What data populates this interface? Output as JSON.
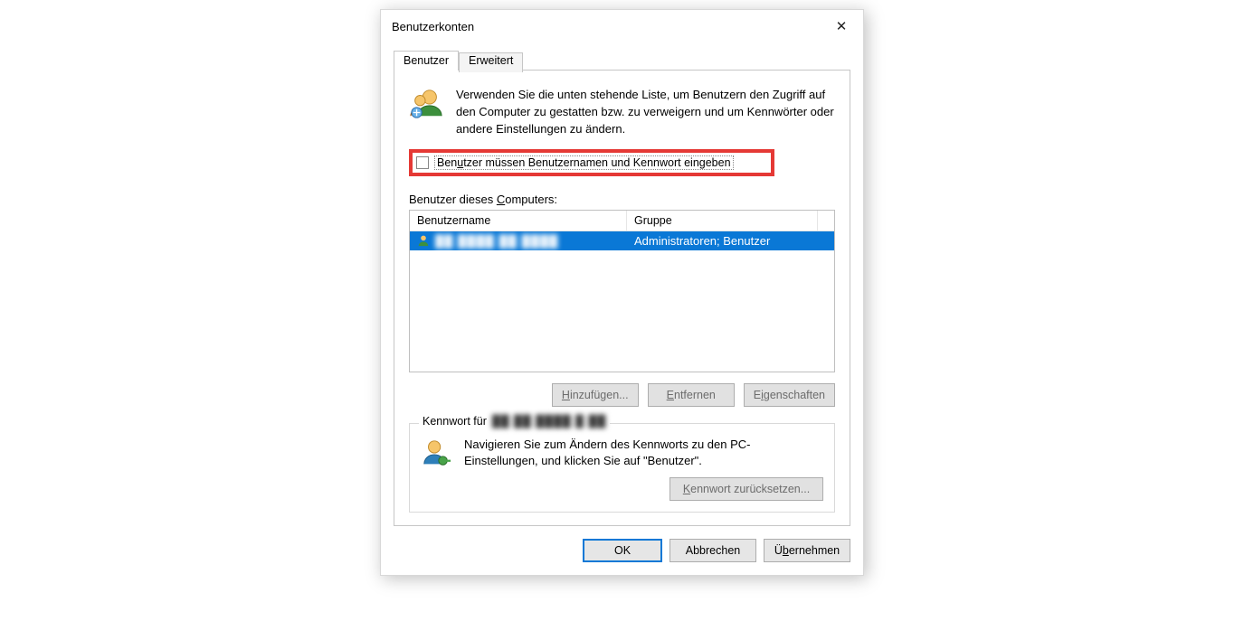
{
  "dialog": {
    "title": "Benutzerkonten",
    "tabs": {
      "users": "Benutzer",
      "advanced": "Erweitert"
    },
    "intro": "Verwenden Sie die unten stehende Liste, um Benutzern den Zugriff auf den Computer zu gestatten bzw. zu verweigern und um Kennwörter oder andere Einstellungen zu ändern.",
    "checkbox_pre": "Ben",
    "checkbox_uk": "u",
    "checkbox_post": "tzer müssen Benutzernamen und Kennwort eingeben",
    "list_label_pre": "Benutzer dieses ",
    "list_label_uk": "C",
    "list_label_post": "omputers:",
    "columns": {
      "username": "Benutzername",
      "group": "Gruppe"
    },
    "row": {
      "username_redacted": "██ ████ ██ ████",
      "group": "Administratoren; Benutzer"
    },
    "buttons": {
      "add_pre": "",
      "add_uk": "H",
      "add_post": "inzufügen...",
      "remove_pre": "",
      "remove_uk": "E",
      "remove_post": "ntfernen",
      "props_pre": "E",
      "props_uk": "i",
      "props_post": "genschaften",
      "reset_pre": "",
      "reset_uk": "K",
      "reset_post": "ennwort zurücksetzen...",
      "ok": "OK",
      "cancel": "Abbrechen",
      "apply_pre": "Ü",
      "apply_uk": "b",
      "apply_post": "ernehmen"
    },
    "group": {
      "legend_prefix": "Kennwort für ",
      "legend_redacted": "██ ██ ████ █ ██",
      "text": "Navigieren Sie zum Ändern des Kennworts zu den PC-Einstellungen, und klicken Sie auf \"Benutzer\"."
    }
  }
}
